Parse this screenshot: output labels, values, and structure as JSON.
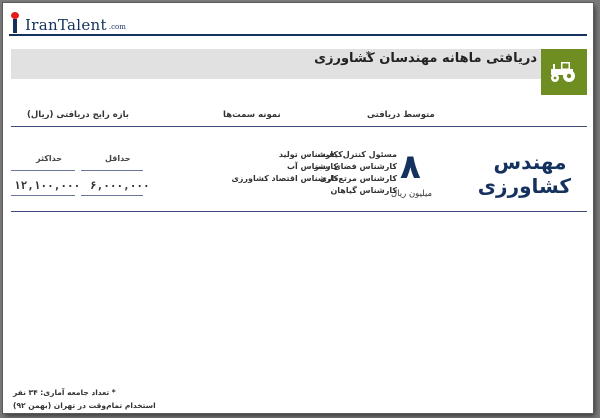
{
  "logo": {
    "text": "IranTalent",
    "domain": ".com"
  },
  "header": {
    "title": "دریافتی ماهانه مهندسان کشاورزی",
    "star": "*"
  },
  "columns": {
    "average": "متوسط دریافتی",
    "positions": "نمونه سمت‌ها",
    "range": "بازه رایج دریافتی (ریال)"
  },
  "range": {
    "min_label": "حداقل",
    "max_label": "حداکثر",
    "min_value": "۶,۰۰۰,۰۰۰",
    "max_value": "۱۲,۱۰۰,۰۰۰"
  },
  "positions_right": [
    "مسئول کنترل‌کیفیت",
    "کارشناس فضای سبز",
    "کارشناس مرتع‌داری",
    "کارشناس گیاهان"
  ],
  "positions_left": [
    "کارشناس تولید",
    "کارشناس آب",
    "کارشناس اقتصاد کشاورزی"
  ],
  "average": {
    "value": "۸",
    "unit": "میلیون ریال"
  },
  "job": {
    "line1": "مهندس",
    "line2": "کشاورزی"
  },
  "footnotes": {
    "line1": "* تعداد جامعه آماری: ۳۴ نفر",
    "line2": "استخدام تمام‌وقت در تهران (بهمن ۹۲)"
  },
  "colors": {
    "navy": "#15325f",
    "green": "#6f8e22",
    "band": "#e1e1e1",
    "red": "#e31d1d"
  },
  "icons": {
    "header": "tractor-icon",
    "logo": "irantalent-logo"
  }
}
